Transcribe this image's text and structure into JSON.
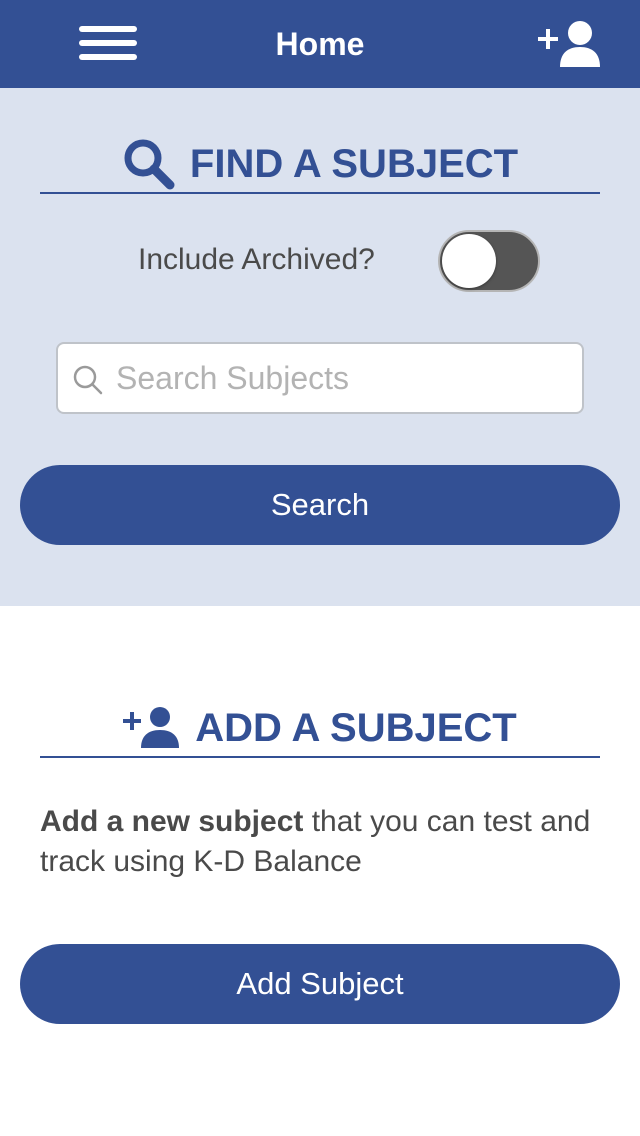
{
  "navbar": {
    "title": "Home",
    "menu_icon": "hamburger-menu-icon",
    "add_icon": "add-user-icon",
    "color": "#335094"
  },
  "find_section": {
    "heading": "FIND A SUBJECT",
    "heading_icon": "search-icon",
    "archived_label": "Include Archived?",
    "archived_toggle_on": false,
    "search_placeholder": "Search Subjects",
    "search_value": "",
    "search_button": "Search",
    "background": "#dbe2ef"
  },
  "add_section": {
    "heading": "ADD A SUBJECT",
    "heading_icon": "add-user-icon",
    "description_bold": "Add a new subject",
    "description_rest": " that you can test and track using K-D Balance",
    "add_button": "Add Subject"
  }
}
